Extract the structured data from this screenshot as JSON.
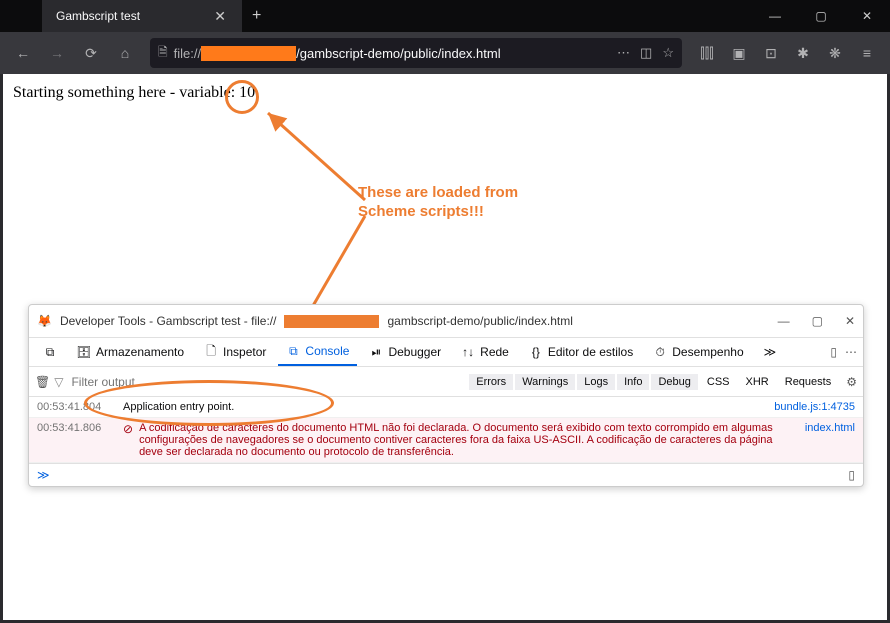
{
  "window": {
    "tab_title": "Gambscript test",
    "minimize": "—",
    "maximize": "▢",
    "close": "✕",
    "newtab": "+"
  },
  "nav": {
    "back": "←",
    "forward": "→",
    "reload": "⟳",
    "home": "⌂",
    "protocol": "file://",
    "path": "/gambscript-demo/public/index.html",
    "dots": "⋯",
    "shield": "◫",
    "star": "☆"
  },
  "toolbar_icons": [
    "⫿⫿⫿",
    "▣",
    "⊡",
    "✱",
    "❋",
    "≡"
  ],
  "page": {
    "body_text": "Starting something here - variable: 10"
  },
  "annotation": {
    "line1": "These are loaded from",
    "line2": "Scheme scripts!!!"
  },
  "devtools": {
    "title_prefix": "Developer Tools - Gambscript test - file://",
    "title_suffix": "gambscript-demo/public/index.html",
    "tabs": {
      "storage": "Armazenamento",
      "inspector": "Inspetor",
      "console": "Console",
      "debugger": "Debugger",
      "network": "Rede",
      "style": "Editor de estilos",
      "perf": "Desempenho",
      "more": "≫"
    },
    "filter_placeholder": "Filter output",
    "chips": {
      "errors": "Errors",
      "warnings": "Warnings",
      "logs": "Logs",
      "info": "Info",
      "debug": "Debug",
      "css": "CSS",
      "xhr": "XHR",
      "requests": "Requests"
    },
    "rows": [
      {
        "ts": "00:53:41.804",
        "msg": "Application entry point.",
        "src": "bundle.js:1:4735"
      },
      {
        "ts": "00:53:41.806",
        "msg": "A codificação de caracteres do documento HTML não foi declarada. O documento será exibido com texto corrompido em algumas configurações de navegadores se o documento contiver caracteres fora da faixa US-ASCII. A codificação de caracteres da página deve ser declarada no documento ou protocolo de transferência.",
        "src": "index.html"
      }
    ],
    "prompt": "≫",
    "split": "▯"
  },
  "colors": {
    "accent": "#ed7d31",
    "link": "#0060df",
    "error": "#a4000f"
  }
}
